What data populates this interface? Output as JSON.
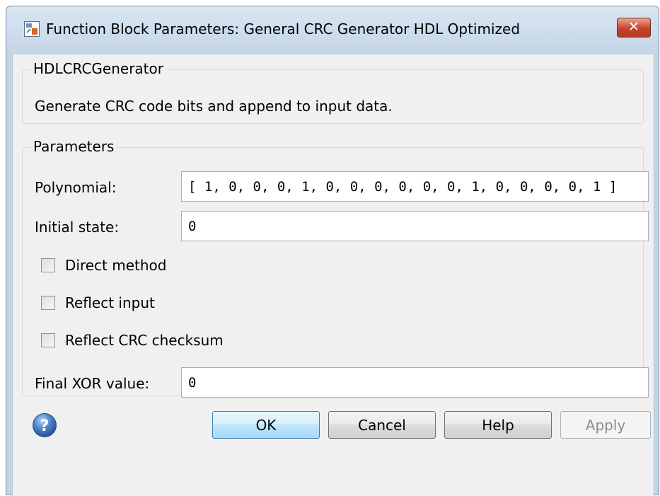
{
  "window": {
    "title": "Function Block Parameters: General CRC Generator HDL Optimized",
    "close_symbol": "✕",
    "icon": "simulink-block-icon"
  },
  "block": {
    "name": "HDLCRCGenerator",
    "description": "Generate CRC code bits and append to input data."
  },
  "parameters": {
    "legend": "Parameters",
    "polynomial_label": "Polynomial:",
    "polynomial_value": "[ 1, 0, 0, 0, 1, 0, 0, 0, 0, 0, 0, 1, 0, 0, 0, 0, 1 ]",
    "initial_state_label": "Initial state:",
    "initial_state_value": "0",
    "direct_method_label": "Direct method",
    "direct_method_checked": false,
    "reflect_input_label": "Reflect input",
    "reflect_input_checked": false,
    "reflect_crc_label": "Reflect CRC checksum",
    "reflect_crc_checked": false,
    "final_xor_label": "Final XOR value:",
    "final_xor_value": "0"
  },
  "buttons": {
    "ok": "OK",
    "cancel": "Cancel",
    "help": "Help",
    "apply": "Apply"
  },
  "colors": {
    "title_bar": "#c5d4e4",
    "dialog_background": "#f0f0f0",
    "close_button": "#c4442a",
    "ok_button_border": "#3c7fb1",
    "help_icon": "#3b6fb6"
  }
}
